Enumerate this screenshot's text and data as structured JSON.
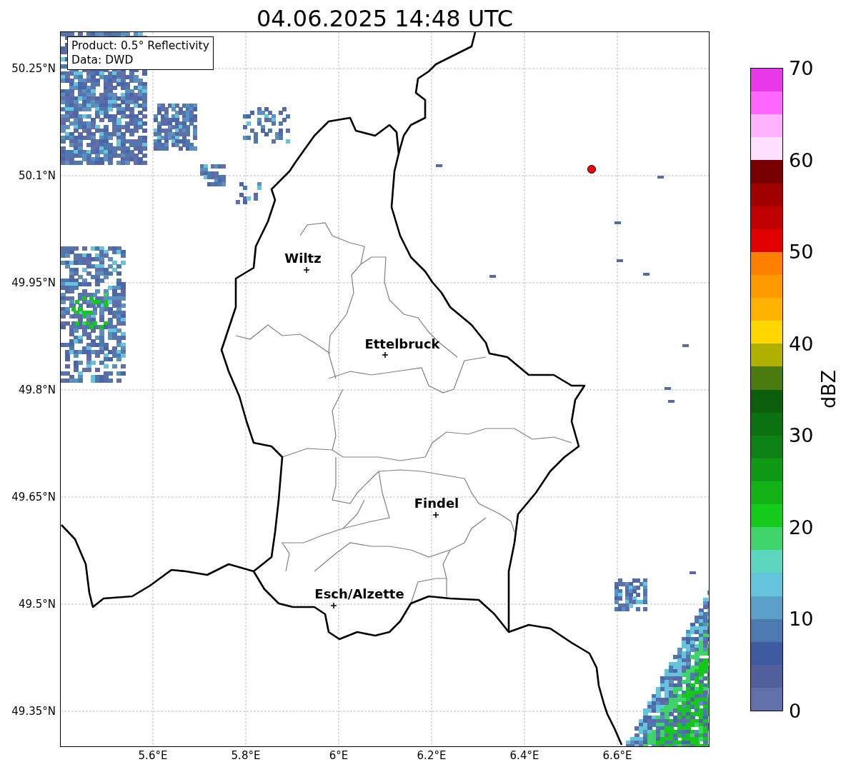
{
  "title": "04.06.2025 14:48 UTC",
  "info_box": {
    "lines": [
      "Product: 0.5° Reflectivity",
      "Data: DWD"
    ]
  },
  "map": {
    "cities": [
      {
        "name": "Wiltz"
      },
      {
        "name": "Ettelbruck"
      },
      {
        "name": "Findel"
      },
      {
        "name": "Esch/Alzette"
      }
    ]
  },
  "axes": {
    "lat_labels": [
      "50.25°N",
      "50.1°N",
      "49.95°N",
      "49.8°N",
      "49.65°N",
      "49.5°N",
      "49.35°N"
    ],
    "lon_labels": [
      "5.6°E",
      "5.8°E",
      "6°E",
      "6.2°E",
      "6.4°E",
      "6.6°E"
    ]
  },
  "colorbar": {
    "label": "dBZ",
    "ticks": [
      "70",
      "60",
      "50",
      "40",
      "30",
      "20",
      "10",
      "0"
    ],
    "segments": [
      {
        "color": "#e83ae8"
      },
      {
        "color": "#ff66ff"
      },
      {
        "color": "#ffb3ff"
      },
      {
        "color": "#ffe0ff"
      },
      {
        "color": "#780000"
      },
      {
        "color": "#a00000"
      },
      {
        "color": "#c00000"
      },
      {
        "color": "#e00000"
      },
      {
        "color": "#ff7f00"
      },
      {
        "color": "#ff9900"
      },
      {
        "color": "#ffb300"
      },
      {
        "color": "#ffd700"
      },
      {
        "color": "#b0b000"
      },
      {
        "color": "#4a7a10"
      },
      {
        "color": "#0b5e0b"
      },
      {
        "color": "#0a7210"
      },
      {
        "color": "#0c8215"
      },
      {
        "color": "#0f9a15"
      },
      {
        "color": "#11b317"
      },
      {
        "color": "#13cc1a"
      },
      {
        "color": "#3ed46a"
      },
      {
        "color": "#5dd6c0"
      },
      {
        "color": "#64c4dc"
      },
      {
        "color": "#5aa0c8"
      },
      {
        "color": "#4a7ab0"
      },
      {
        "color": "#405aa0"
      },
      {
        "color": "#50609a"
      },
      {
        "color": "#6070a8"
      }
    ]
  }
}
